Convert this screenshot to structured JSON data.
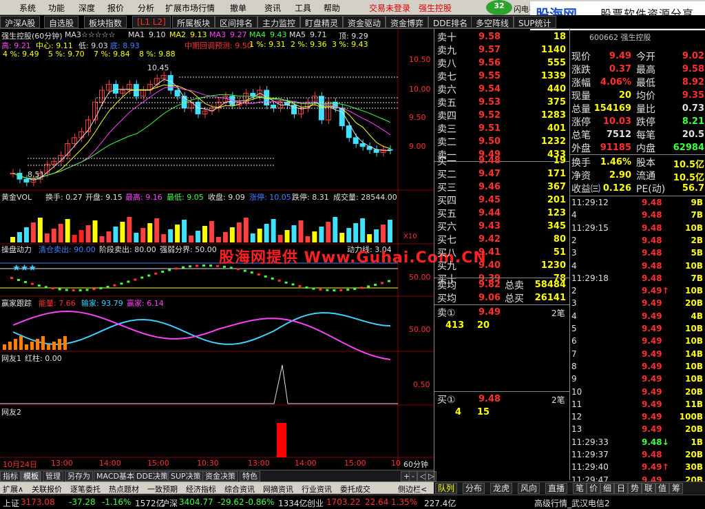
{
  "menubar": {
    "items": [
      "系统",
      "功能",
      "深度",
      "报价",
      "分析",
      "扩展市场行情",
      "撤单",
      "资讯",
      "工具",
      "帮助"
    ],
    "trade_status": "交易未登录",
    "stock_name": "强生控股",
    "badge_count": "32",
    "flash_label": "闪电手"
  },
  "watermark": {
    "brand": "股海网",
    "subtitle": "股票软件资源分享",
    "url": "www.Guhai.com.cn"
  },
  "tabs": [
    "沪深A股",
    "自选股",
    "板块指数",
    "[L1 L2]",
    "所属板块",
    "区间排名",
    "主力监控",
    "盯盘精灵",
    "资金驱动",
    "资金博弈",
    "DDE排名",
    "多空阵线",
    "SUP统计"
  ],
  "chart": {
    "title": "强生控股(60分钟)",
    "ma_label": "MA3☆☆☆☆☆",
    "ma": [
      {
        "name": "MA1",
        "value": "9.10"
      },
      {
        "name": "MA2",
        "value": "9.13"
      },
      {
        "name": "MA3",
        "value": "9.27"
      },
      {
        "name": "MA4",
        "value": "9.43"
      },
      {
        "name": "MA5",
        "value": "9.71"
      }
    ],
    "top_label": "顶: 9.29",
    "row2": {
      "high": "高: 9.21",
      "mid": "中心: 9.11",
      "low": "低: 9.03",
      "base": "底: 8.93",
      "mid_forecast": "中期回调预测: 9.50",
      "p1": "1 %: 9.31",
      "p2": "2 %: 9.36",
      "p3": "3 %: 9.43"
    },
    "row3": {
      "p4": "4 %: 9.49",
      "p5": "5 %: 9.70",
      "p7": "7 %: 9.84",
      "p8": "8 %: 9.88"
    },
    "price_axis": [
      "10.50",
      "10.00",
      "9.50",
      "9.00"
    ],
    "high_marker": "10.45",
    "low_marker": "8.51",
    "vol": {
      "title": "黄金VOL",
      "turnover": "换手: 0.27",
      "open": "开盘: 9.15",
      "high": "最高: 9.16",
      "low": "最低: 9.05",
      "close": "收盘: 9.09",
      "limit_up": "涨停: 10.05",
      "limit_down": "跌停: 8.31",
      "volume": "成交量: 28544.00",
      "scale": "X10"
    },
    "power": {
      "title": "操盘动力",
      "clear": "清仓卖出: 90.00",
      "stage": "阶段卖出: 80.00",
      "boundary": "强弱分界: 50.00",
      "line": "动力线: 3.04",
      "axis": "50.00"
    },
    "winner": {
      "title": "赢家跟踪",
      "energy": "能量: 7.66",
      "loser": "输家: 93.79",
      "winner": "赢家: 6.14",
      "axis": "50.00"
    },
    "friend1": {
      "title": "网友1",
      "red": "红柱: 0.00",
      "axis": "0.50"
    },
    "friend2": {
      "title": "网友2"
    },
    "time_axis": [
      "10月24日",
      "13:00",
      "14:00",
      "15:00",
      "10:30",
      "13:00",
      "14:00",
      "15:00",
      "10"
    ],
    "period": "60分钟",
    "overlay": "股海网提供 Www.Guhai.Com.CN",
    "stars": "★★★"
  },
  "bottom_tabs": [
    "指标",
    "模板",
    "管理",
    "另存为",
    "MACD基本",
    "DDE决策",
    "SUP决策",
    "资金决策",
    "特色"
  ],
  "zoom_buttons": [
    "+",
    "-",
    "◁",
    "▷"
  ],
  "status_tabs": [
    "扩展∧",
    "关联报价",
    "逐笔委托",
    "热点题材",
    "一致预期",
    "经济指标",
    "综合资讯",
    "网摘资讯",
    "行业资讯",
    "委托成交",
    "侧边栏<"
  ],
  "sell_book": [
    {
      "name": "卖十",
      "price": "9.58",
      "vol": "18"
    },
    {
      "name": "卖九",
      "price": "9.57",
      "vol": "1140"
    },
    {
      "name": "卖八",
      "price": "9.56",
      "vol": "555"
    },
    {
      "name": "卖七",
      "price": "9.55",
      "vol": "1339"
    },
    {
      "name": "卖六",
      "price": "9.54",
      "vol": "440"
    },
    {
      "name": "卖五",
      "price": "9.53",
      "vol": "375"
    },
    {
      "name": "卖四",
      "price": "9.52",
      "vol": "1283"
    },
    {
      "name": "卖三",
      "price": "9.51",
      "vol": "401"
    },
    {
      "name": "卖二",
      "price": "9.50",
      "vol": "1232"
    },
    {
      "name": "卖一",
      "price": "9.49",
      "vol": "433"
    }
  ],
  "buy_book": [
    {
      "name": "买一",
      "price": "9.48",
      "vol": "19"
    },
    {
      "name": "买二",
      "price": "9.47",
      "vol": "171"
    },
    {
      "name": "买三",
      "price": "9.46",
      "vol": "367"
    },
    {
      "name": "买四",
      "price": "9.45",
      "vol": "201"
    },
    {
      "name": "买五",
      "price": "9.44",
      "vol": "123"
    },
    {
      "name": "买六",
      "price": "9.43",
      "vol": "345"
    },
    {
      "name": "买七",
      "price": "9.42",
      "vol": "80"
    },
    {
      "name": "买八",
      "price": "9.41",
      "vol": "51"
    },
    {
      "name": "买九",
      "price": "9.40",
      "vol": "1230"
    },
    {
      "name": "买十",
      "price": "9.39",
      "vol": "78"
    }
  ],
  "avg": {
    "sell_avg_label": "卖均",
    "sell_avg": "9.82",
    "total_sell_label": "总卖",
    "total_sell": "58484",
    "buy_avg_label": "买均",
    "buy_avg": "9.06",
    "total_buy_label": "总买",
    "total_buy": "26141"
  },
  "queue": {
    "sell1_label": "卖①",
    "sell1_price": "9.49",
    "sell1_count": "2笔",
    "sell1_q1": "413",
    "sell1_q2": "20",
    "buy1_label": "买①",
    "buy1_price": "9.48",
    "buy1_count": "2笔",
    "buy1_q1": "4",
    "buy1_q2": "15"
  },
  "quote": {
    "code": "600662 强生控股",
    "rows": [
      {
        "k1": "现价",
        "v1": "9.49",
        "k2": "今开",
        "v2": "9.02"
      },
      {
        "k1": "涨跌",
        "v1": "0.37",
        "k2": "最高",
        "v2": "9.58"
      },
      {
        "k1": "涨幅",
        "v1": "4.06%",
        "k2": "最低",
        "v2": "8.92"
      },
      {
        "k1": "现量",
        "v1": "20",
        "k2": "均价",
        "v2": "9.35"
      },
      {
        "k1": "总量",
        "v1": "154169",
        "k2": "量比",
        "v2": "0.73"
      },
      {
        "k1": "涨停",
        "v1": "10.03",
        "k2": "跌停",
        "v2": "8.21"
      },
      {
        "k1": "总笔",
        "v1": "7512",
        "k2": "每笔",
        "v2": "20.5"
      },
      {
        "k1": "外盘",
        "v1": "91185",
        "k2": "内盘",
        "v2": "62984"
      }
    ],
    "rows2": [
      {
        "k1": "换手",
        "v1": "1.46%",
        "k2": "股本",
        "v2": "10.5亿"
      },
      {
        "k1": "净资",
        "v1": "2.90",
        "k2": "流通",
        "v2": "10.5亿"
      },
      {
        "k1": "收益㈢",
        "v1": "0.126",
        "k2": "PE(动)",
        "v2": "56.7"
      }
    ]
  },
  "ticks": [
    {
      "t": "11:29:12",
      "p": "9.48",
      "v": "9B"
    },
    {
      "t": "4",
      "p": "9.48",
      "v": "7B"
    },
    {
      "t": "11:29:15",
      "p": "9.48",
      "v": "10B"
    },
    {
      "t": "2",
      "p": "9.48",
      "v": "2B"
    },
    {
      "t": "3",
      "p": "9.48",
      "v": "5B"
    },
    {
      "t": "4",
      "p": "9.48",
      "v": "10B"
    },
    {
      "t": "11:29:18",
      "p": "9.48",
      "v": "7B"
    },
    {
      "t": "2",
      "p": "9.49↑",
      "v": "10B"
    },
    {
      "t": "3",
      "p": "9.49",
      "v": "20B"
    },
    {
      "t": "4",
      "p": "9.49",
      "v": "4B"
    },
    {
      "t": "5",
      "p": "9.49",
      "v": "10B"
    },
    {
      "t": "6",
      "p": "9.49",
      "v": "10B"
    },
    {
      "t": "7",
      "p": "9.49",
      "v": "14B"
    },
    {
      "t": "8",
      "p": "9.49",
      "v": "10B"
    },
    {
      "t": "9",
      "p": "9.49",
      "v": "10B"
    },
    {
      "t": "10",
      "p": "9.49",
      "v": "20B"
    },
    {
      "t": "11",
      "p": "9.49",
      "v": "11B"
    },
    {
      "t": "12",
      "p": "9.49",
      "v": "100B"
    },
    {
      "t": "13",
      "p": "9.49",
      "v": "20B"
    },
    {
      "t": "11:29:33",
      "p": "9.48↓",
      "v": "1B"
    },
    {
      "t": "11:29:37",
      "p": "9.48",
      "v": "20B"
    },
    {
      "t": "11:29:40",
      "p": "9.49↑",
      "v": "30B"
    },
    {
      "t": "11:29:47",
      "p": "9.49",
      "v": "20B"
    }
  ],
  "right_tabs": [
    "队列",
    "分布",
    "龙虎",
    "风向",
    "直播",
    "笔",
    "价",
    "细",
    "日",
    "势",
    "联",
    "值",
    "筹"
  ],
  "ticker": {
    "sh_label": "上证",
    "sh_val": "3173.08",
    "sh_chg": "-37.28",
    "sh_pct": "-1.16%",
    "sh_amt": "1572亿",
    "hs_label": "沪深",
    "hs_val": "3404.77",
    "hs_chg": "-29.62",
    "hs_pct": "-0.86%",
    "hs_amt": "1334亿",
    "cy_label": "创业",
    "cy_val": "1703.22",
    "cy_chg": "22.64",
    "cy_pct": "1.35%",
    "cy_amt": "227.4亿",
    "extra": "高级行情_武汉电信2"
  },
  "colors": {
    "up": "#ff3030",
    "down": "#40ff40",
    "yellow": "#ffff00",
    "cyan": "#40d0ff",
    "magenta": "#ff40ff"
  }
}
